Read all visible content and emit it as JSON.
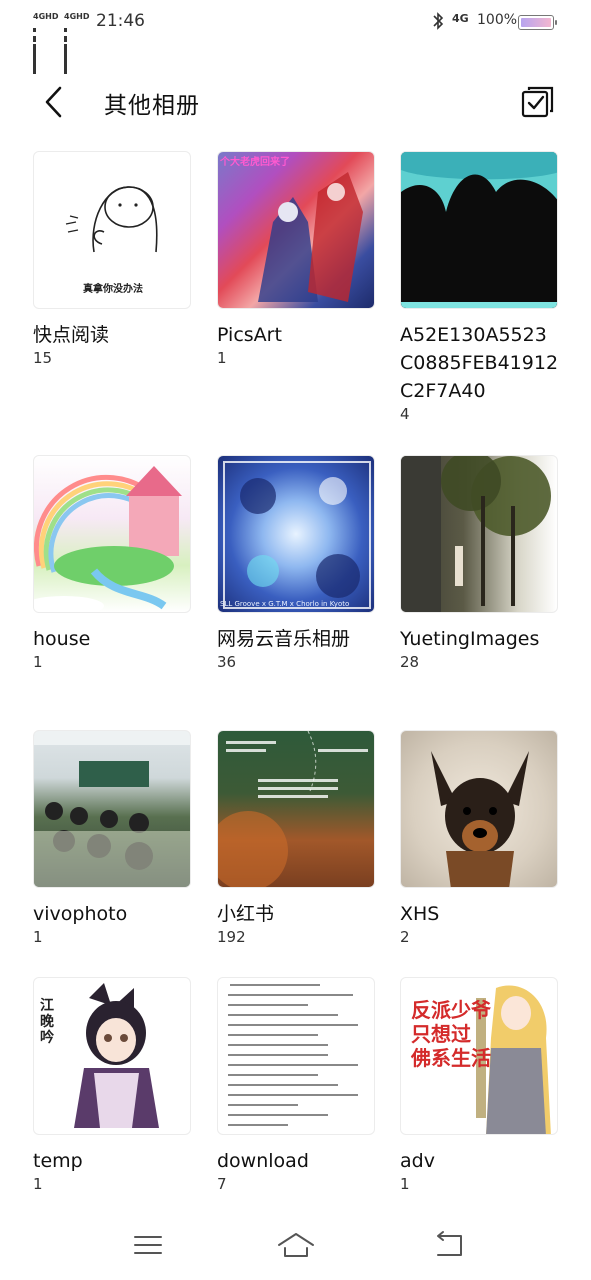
{
  "status_bar": {
    "signal1": "4GHD",
    "signal2": "4GHD",
    "time": "21:46",
    "network": "4G",
    "battery_pct": "100%",
    "icons": [
      "bluetooth-icon",
      "battery-icon"
    ]
  },
  "header": {
    "title": "其他相册",
    "back_icon": "chevron-left-icon",
    "select_icon": "multi-select-icon"
  },
  "albums": [
    {
      "name": "快点阅读",
      "count": "15",
      "thumb_caption": "真拿你没办法"
    },
    {
      "name": "PicsArt",
      "count": "1",
      "thumb_caption": "个大老虎回来了"
    },
    {
      "name": "A52E130A5523C0885FEB41912C2F7A40",
      "count": "4"
    },
    {
      "name": "house",
      "count": "1"
    },
    {
      "name": "网易云音乐相册",
      "count": "36",
      "thumb_caption": "SLL Groove x G.T.M x Chorlo in Kyoto"
    },
    {
      "name": "YuetingImages",
      "count": "28"
    },
    {
      "name": "vivophoto",
      "count": "1"
    },
    {
      "name": "小红书",
      "count": "192"
    },
    {
      "name": "XHS",
      "count": "2"
    },
    {
      "name": "temp",
      "count": "1",
      "thumb_caption": "江晚吟"
    },
    {
      "name": "download",
      "count": "7"
    },
    {
      "name": "adv",
      "count": "1",
      "thumb_caption": "反派少爷 只想过 佛系生活"
    }
  ],
  "nav_bar": {
    "menu_icon": "menu-icon",
    "home_icon": "home-icon",
    "back_icon": "back-icon"
  },
  "colors": {
    "background": "#ffffff",
    "text": "#111111",
    "count_text": "#333333"
  }
}
